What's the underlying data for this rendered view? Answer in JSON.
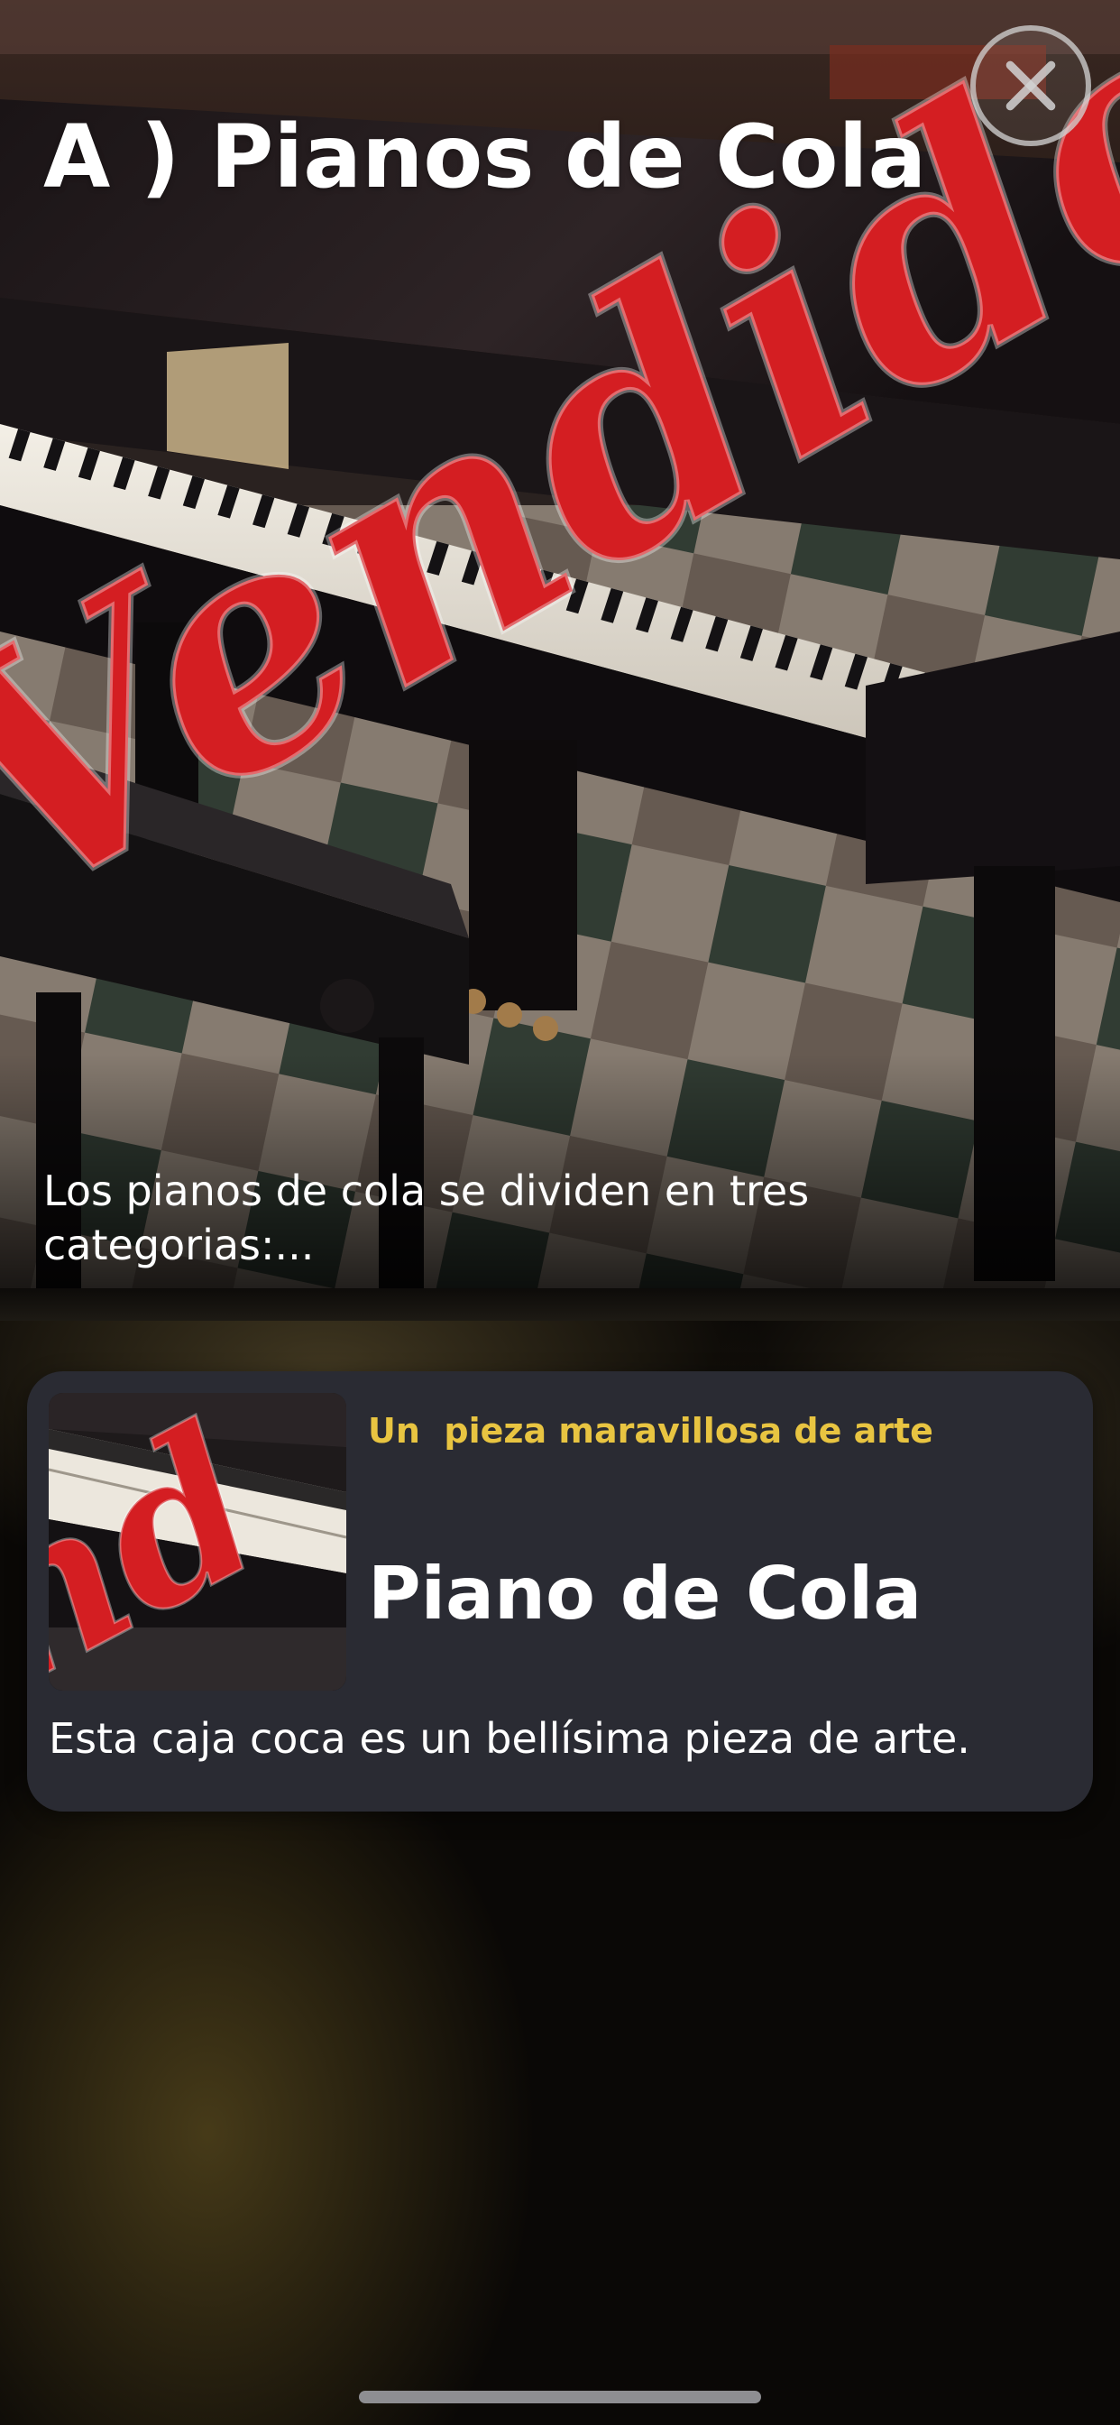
{
  "header": {
    "title": "A ) Pianos de Cola",
    "description": "Los pianos de cola se dividen en tres categorias:...",
    "close_icon": "close-icon",
    "hero_image": "grand-piano-photo",
    "watermark_text": "Vendido",
    "watermark_color": "#d41e22"
  },
  "card": {
    "tagline": "Un  pieza maravillosa de arte",
    "title": "Piano de Cola",
    "body": "Esta caja coca es un bellísima pieza de arte.",
    "thumbnail": "grand-piano-thumbnail",
    "accent_color": "#e8c441",
    "background_color": "#2a2b33"
  },
  "system": {
    "home_indicator": "home-indicator"
  }
}
